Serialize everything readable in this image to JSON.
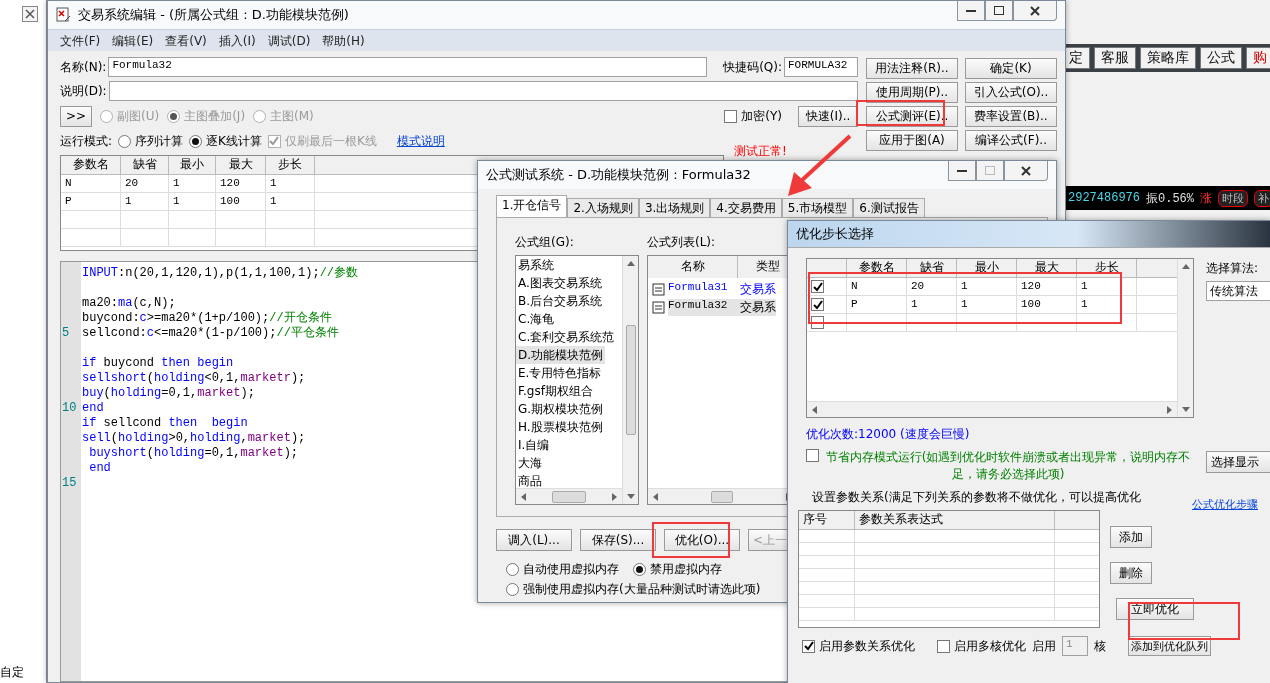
{
  "background_left": {
    "label": "自定"
  },
  "background_right": {
    "toolbar": [
      {
        "label": "定",
        "kind": "plain"
      },
      {
        "label": "客服",
        "kind": "plain"
      },
      {
        "label": "策略库",
        "kind": "plain"
      },
      {
        "label": "公式",
        "kind": "plain"
      },
      {
        "label": "购",
        "kind": "alert"
      }
    ],
    "quote": "2927486976",
    "amplitude": "振0.56%",
    "rise": "涨",
    "tags": [
      "时段",
      "补"
    ]
  },
  "editor": {
    "title": "交易系统编辑 - (所属公式组 : D.功能模块范例)",
    "menu": [
      "文件(F)",
      "编辑(E)",
      "查看(V)",
      "插入(I)",
      "调试(D)",
      "帮助(H)"
    ],
    "name_label": "名称(N):",
    "name_value": "Formula32",
    "shortcut_label": "快捷码(Q):",
    "shortcut_value": "FORMULA32",
    "desc_label": "说明(D):",
    "expand": ">>",
    "chart_types": [
      {
        "label": "副图(U)",
        "selected": false
      },
      {
        "label": "主图叠加(J)",
        "selected": true
      },
      {
        "label": "主图(M)",
        "selected": false
      }
    ],
    "encrypt": {
      "label": "加密(Y)",
      "checked": false
    },
    "quick": "快速(I)..",
    "buttons": [
      [
        "用法注释(R)..",
        "确定(K)"
      ],
      [
        "使用周期(P)..",
        "引入公式(O).."
      ],
      [
        "公式测评(E)..",
        "费率设置(B).."
      ],
      [
        "应用于图(A)",
        "编译公式(F).."
      ]
    ],
    "run_mode_label": "运行模式:",
    "run_modes": [
      {
        "label": "序列计算",
        "selected": false
      },
      {
        "label": "逐K线计算",
        "selected": true
      }
    ],
    "refresh_last": {
      "label": "仅刷最后一根K线",
      "checked": true,
      "disabled": true
    },
    "mode_link": "模式说明",
    "status": "测试正常!",
    "params": {
      "columns": [
        "参数名",
        "缺省",
        "最小",
        "最大",
        "步长"
      ],
      "rows": [
        [
          "N",
          "20",
          "1",
          "120",
          "1"
        ],
        [
          "P",
          "1",
          "1",
          "100",
          "1"
        ]
      ]
    },
    "code": [
      {
        "kind": "code",
        "tokens": [
          {
            "kind": "keyword",
            "text": "INPUT"
          },
          {
            "kind": "plain",
            "text": ":n(20,1,120,1),p(1,1,100,1);"
          },
          {
            "kind": "comment",
            "text": "//参数"
          }
        ]
      },
      {
        "kind": "blank"
      },
      {
        "kind": "code",
        "tokens": [
          {
            "kind": "plain",
            "text": "ma20:"
          },
          {
            "kind": "keyword",
            "text": "ma"
          },
          {
            "kind": "plain",
            "text": "(c,N);"
          }
        ]
      },
      {
        "kind": "code",
        "tokens": [
          {
            "kind": "plain",
            "text": "buycond:"
          },
          {
            "kind": "keyword",
            "text": "c"
          },
          {
            "kind": "plain",
            "text": ">=ma20*(1+p/100);"
          },
          {
            "kind": "comment",
            "text": "//开仓条件"
          }
        ]
      },
      {
        "kind": "code",
        "number": "5",
        "tokens": [
          {
            "kind": "plain",
            "text": "sellcond:"
          },
          {
            "kind": "keyword",
            "text": "c"
          },
          {
            "kind": "plain",
            "text": "<=ma20*(1-p/100);"
          },
          {
            "kind": "comment",
            "text": "//平仓条件"
          }
        ]
      },
      {
        "kind": "blank"
      },
      {
        "kind": "code",
        "tokens": [
          {
            "kind": "keyword",
            "text": "if"
          },
          {
            "kind": "plain",
            "text": " buycond "
          },
          {
            "kind": "keyword",
            "text": "then begin"
          }
        ]
      },
      {
        "kind": "code",
        "tokens": [
          {
            "kind": "keyword",
            "text": "sellshort"
          },
          {
            "kind": "plain",
            "text": "("
          },
          {
            "kind": "keyword",
            "text": "holding"
          },
          {
            "kind": "plain",
            "text": "<0,1,"
          },
          {
            "kind": "constant",
            "text": "marketr"
          },
          {
            "kind": "plain",
            "text": ");"
          }
        ]
      },
      {
        "kind": "code",
        "tokens": [
          {
            "kind": "keyword",
            "text": "buy"
          },
          {
            "kind": "plain",
            "text": "("
          },
          {
            "kind": "keyword",
            "text": "holding"
          },
          {
            "kind": "plain",
            "text": "=0,1,"
          },
          {
            "kind": "constant",
            "text": "market"
          },
          {
            "kind": "plain",
            "text": ");"
          }
        ]
      },
      {
        "kind": "code",
        "number": "10",
        "tokens": [
          {
            "kind": "keyword",
            "text": "end"
          }
        ]
      },
      {
        "kind": "code",
        "tokens": [
          {
            "kind": "keyword",
            "text": "if"
          },
          {
            "kind": "plain",
            "text": " sellcond "
          },
          {
            "kind": "keyword",
            "text": "then  begin"
          }
        ]
      },
      {
        "kind": "code",
        "tokens": [
          {
            "kind": "keyword",
            "text": "sell"
          },
          {
            "kind": "plain",
            "text": "("
          },
          {
            "kind": "keyword",
            "text": "holding"
          },
          {
            "kind": "plain",
            "text": ">0,"
          },
          {
            "kind": "keyword",
            "text": "holding"
          },
          {
            "kind": "plain",
            "text": ","
          },
          {
            "kind": "constant",
            "text": "market"
          },
          {
            "kind": "plain",
            "text": ");"
          }
        ]
      },
      {
        "kind": "code",
        "tokens": [
          {
            "kind": "keyword",
            "text": " buyshort"
          },
          {
            "kind": "plain",
            "text": "("
          },
          {
            "kind": "keyword",
            "text": "holding"
          },
          {
            "kind": "plain",
            "text": "=0,1,"
          },
          {
            "kind": "constant",
            "text": "market"
          },
          {
            "kind": "plain",
            "text": ");"
          }
        ]
      },
      {
        "kind": "code",
        "tokens": [
          {
            "kind": "keyword",
            "text": " end"
          }
        ]
      },
      {
        "kind": "blank",
        "number": "15"
      }
    ]
  },
  "tester": {
    "title": "公式测试系统 - D.功能模块范例 : Formula32",
    "tabs": [
      {
        "label": "1.开仓信号",
        "selected": true
      },
      {
        "label": "2.入场规则",
        "selected": false
      },
      {
        "label": "3.出场规则",
        "selected": false
      },
      {
        "label": "4.交易费用",
        "selected": false
      },
      {
        "label": "5.市场模型",
        "selected": false
      },
      {
        "label": "6.测试报告",
        "selected": false
      }
    ],
    "group_label": "公式组(G):",
    "groups": [
      {
        "label": "易系统",
        "selected": false
      },
      {
        "label": "A.图表交易系统",
        "selected": false
      },
      {
        "label": "B.后台交易系统",
        "selected": false
      },
      {
        "label": "C.海龟",
        "selected": false
      },
      {
        "label": "C.套利交易系统范",
        "selected": false
      },
      {
        "label": "D.功能模块范例",
        "selected": true
      },
      {
        "label": "E.专用特色指标",
        "selected": false
      },
      {
        "label": "F.gsf期权组合",
        "selected": false
      },
      {
        "label": "G.期权模块范例",
        "selected": false
      },
      {
        "label": "H.股票模块范例",
        "selected": false
      },
      {
        "label": "I.自编",
        "selected": false
      },
      {
        "label": "大海",
        "selected": false
      },
      {
        "label": "商品",
        "selected": false
      }
    ],
    "list_label": "公式列表(L):",
    "list_columns": [
      "名称",
      "类型"
    ],
    "formulas": [
      {
        "name": "Formula31",
        "type": "交易系",
        "selected": false,
        "hover": true
      },
      {
        "name": "Formula32",
        "type": "交易系",
        "selected": true,
        "hover": false
      }
    ],
    "buttons": [
      {
        "label": "调入(L)...",
        "disabled": false
      },
      {
        "label": "保存(S)...",
        "disabled": false
      },
      {
        "label": "优化(O)...",
        "disabled": false
      },
      {
        "label": "<上一",
        "disabled": true
      }
    ],
    "memory": [
      {
        "label": "自动使用虚拟内存",
        "selected": false
      },
      {
        "label": "禁用虚拟内存",
        "selected": true
      },
      {
        "label": "强制使用虚拟内存(大量品种测试时请选此项)",
        "selected": false
      }
    ]
  },
  "optimizer": {
    "title": "优化步长选择",
    "columns": [
      "参数名",
      "缺省",
      "最小",
      "最大",
      "步长"
    ],
    "rows": [
      {
        "checked": true,
        "cells": [
          "N",
          "20",
          "1",
          "120",
          "1"
        ]
      },
      {
        "checked": true,
        "cells": [
          "P",
          "1",
          "1",
          "100",
          "1"
        ]
      },
      {
        "checked": false
      }
    ],
    "algorithm_label": "选择算法:",
    "algorithm": "传统算法",
    "columns_button": "选择显示",
    "count": "优化次数:12000 (速度会巨慢)",
    "save_memory": {
      "label": "节省内存模式运行(如遇到优化时软件崩溃或者出现异常，说明内存不足，请务必选择此项)",
      "checked": false
    },
    "relation_label": "设置参数关系(满足下列关系的参数将不做优化，可以提高优化",
    "steps_link": "公式优化步骤",
    "relation_columns": [
      "序号",
      "参数关系表达式"
    ],
    "add": "添加",
    "remove": "删除",
    "run": "立即优化",
    "queue": "添加到优化队列",
    "enable_relation": {
      "label": "启用参数关系优化",
      "checked": true
    },
    "multicore": {
      "label": "启用多核优化",
      "checked": false
    },
    "cores_label": "启用",
    "cores": "1",
    "cores_unit": "核"
  }
}
